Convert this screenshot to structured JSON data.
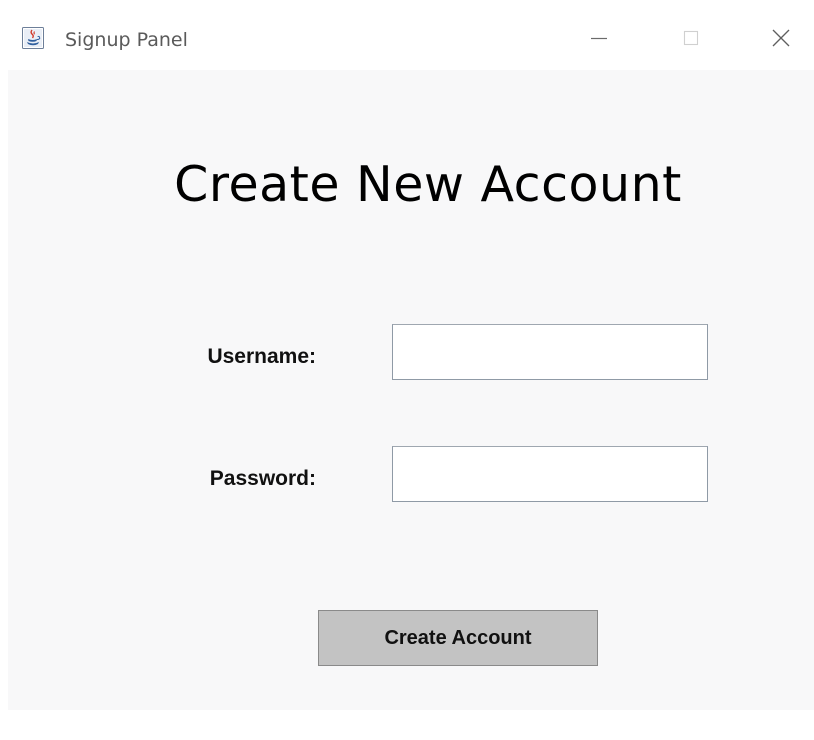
{
  "window": {
    "title": "Signup Panel",
    "app_icon": "java-cup-icon",
    "controls": {
      "minimize_icon": "minimize-icon",
      "maximize_icon": "maximize-icon",
      "close_icon": "close-icon"
    }
  },
  "form": {
    "heading": "Create New Account",
    "username_label": "Username:",
    "username_value": "",
    "password_label": "Password:",
    "password_value": "",
    "submit_label": "Create Account"
  },
  "colors": {
    "content_background": "#f8f8f9",
    "button_background": "#c3c3c3",
    "field_border": "#8f9aa6"
  }
}
